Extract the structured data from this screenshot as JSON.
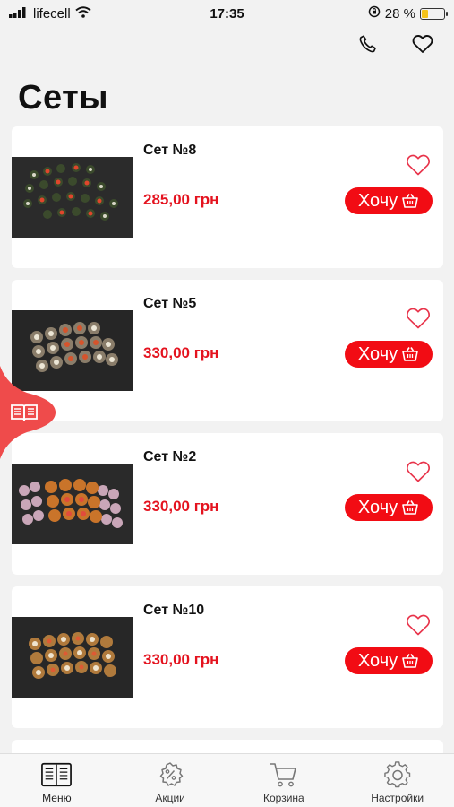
{
  "status_bar": {
    "carrier": "lifecell",
    "time": "17:35",
    "battery_percent": "28 %",
    "battery_level": 0.28
  },
  "header": {
    "title": "Сеты",
    "phone_icon": "phone-icon",
    "favorites_icon": "heart-icon"
  },
  "products": [
    {
      "name": "Сет №8",
      "price": "285,00 грн",
      "button_label": "Хочу"
    },
    {
      "name": "Сет №5",
      "price": "330,00 грн",
      "button_label": "Хочу"
    },
    {
      "name": "Сет №2",
      "price": "330,00 грн",
      "button_label": "Хочу"
    },
    {
      "name": "Сет №10",
      "price": "330,00 грн",
      "button_label": "Хочу"
    }
  ],
  "tab_bar": {
    "tabs": [
      {
        "label": "Меню",
        "icon": "menu-book-icon",
        "active": true
      },
      {
        "label": "Акции",
        "icon": "discount-gear-icon",
        "active": false
      },
      {
        "label": "Корзина",
        "icon": "cart-icon",
        "active": false
      },
      {
        "label": "Настройки",
        "icon": "settings-gear-icon",
        "active": false
      }
    ]
  },
  "colors": {
    "accent": "#f20c14",
    "price": "#e4131f",
    "bubble": "#ef4b4b",
    "battery": "#f4c31a"
  }
}
